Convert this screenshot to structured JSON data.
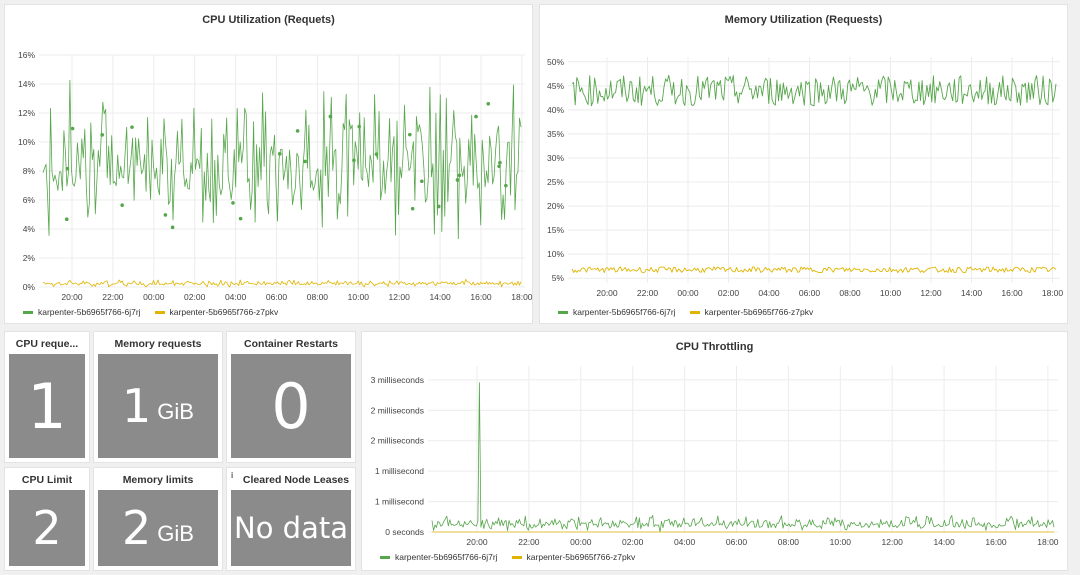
{
  "panels": {
    "cpu_util": {
      "title": "CPU Utilization (Requets)"
    },
    "mem_util": {
      "title": "Memory Utilization (Requests)"
    },
    "cpu_throttling": {
      "title": "CPU Throttling"
    }
  },
  "legend": {
    "series_a": "karpenter-5b6965f766-6j7rj",
    "series_b": "karpenter-5b6965f766-z7pkv"
  },
  "colors": {
    "series_a": "#56a64b",
    "series_b": "#e0b400",
    "stat_bg": "#8b8b8b",
    "grid": "#ececec"
  },
  "stats": {
    "cpu_requests": {
      "title": "CPU reque...",
      "value": "1"
    },
    "memory_requests": {
      "title": "Memory requests",
      "value": "1",
      "unit": "GiB"
    },
    "container_restarts": {
      "title": "Container Restarts",
      "value": "0"
    },
    "cpu_limit": {
      "title": "CPU Limit",
      "value": "2"
    },
    "memory_limits": {
      "title": "Memory limits",
      "value": "2",
      "unit": "GiB"
    },
    "cleared_node_leases": {
      "title": "Cleared Node Leases",
      "value": "No data",
      "info_icon": "i"
    }
  },
  "chart_data": [
    {
      "id": "cpu_util",
      "type": "line",
      "title": "CPU Utilization (Requets)",
      "y_ticks": [
        "0%",
        "2%",
        "4%",
        "6%",
        "8%",
        "10%",
        "12%",
        "14%",
        "16%"
      ],
      "x_ticks": [
        "20:00",
        "22:00",
        "00:00",
        "02:00",
        "04:00",
        "06:00",
        "08:00",
        "10:00",
        "12:00",
        "14:00",
        "16:00",
        "18:00"
      ],
      "ylim": [
        0,
        16
      ],
      "grid": true,
      "legend_position": "bottom-left",
      "series": [
        {
          "name": "karpenter-5b6965f766-6j7rj",
          "color": "#56a64b",
          "typical_range": [
            3,
            14
          ]
        },
        {
          "name": "karpenter-5b6965f766-z7pkv",
          "color": "#e0b400",
          "typical_range": [
            0,
            0.5
          ]
        }
      ]
    },
    {
      "id": "mem_util",
      "type": "line",
      "title": "Memory Utilization (Requests)",
      "y_ticks": [
        "5%",
        "10%",
        "15%",
        "20%",
        "25%",
        "30%",
        "35%",
        "40%",
        "45%",
        "50%"
      ],
      "x_ticks": [
        "20:00",
        "22:00",
        "00:00",
        "02:00",
        "04:00",
        "06:00",
        "08:00",
        "10:00",
        "12:00",
        "14:00",
        "16:00",
        "18:00"
      ],
      "ylim": [
        4,
        51
      ],
      "grid": true,
      "legend_position": "bottom-left",
      "series": [
        {
          "name": "karpenter-5b6965f766-6j7rj",
          "color": "#56a64b",
          "typical_range": [
            40,
            48
          ]
        },
        {
          "name": "karpenter-5b6965f766-z7pkv",
          "color": "#e0b400",
          "typical_range": [
            6,
            7.5
          ]
        }
      ]
    },
    {
      "id": "cpu_throttling",
      "type": "line",
      "title": "CPU Throttling",
      "y_ticks": [
        "0 seconds",
        "1 millisecond",
        "1 millisecond",
        "2 milliseconds",
        "2 milliseconds",
        "3 milliseconds"
      ],
      "x_ticks": [
        "20:00",
        "22:00",
        "00:00",
        "02:00",
        "04:00",
        "06:00",
        "08:00",
        "10:00",
        "12:00",
        "14:00",
        "16:00",
        "18:00"
      ],
      "ylim": [
        0,
        3
      ],
      "grid": true,
      "legend_position": "bottom-left",
      "series": [
        {
          "name": "karpenter-5b6965f766-6j7rj",
          "color": "#56a64b",
          "typical_range": [
            0,
            0.3
          ],
          "peak": 2.7
        },
        {
          "name": "karpenter-5b6965f766-z7pkv",
          "color": "#e0b400",
          "typical_range": [
            0,
            0
          ]
        }
      ]
    }
  ]
}
